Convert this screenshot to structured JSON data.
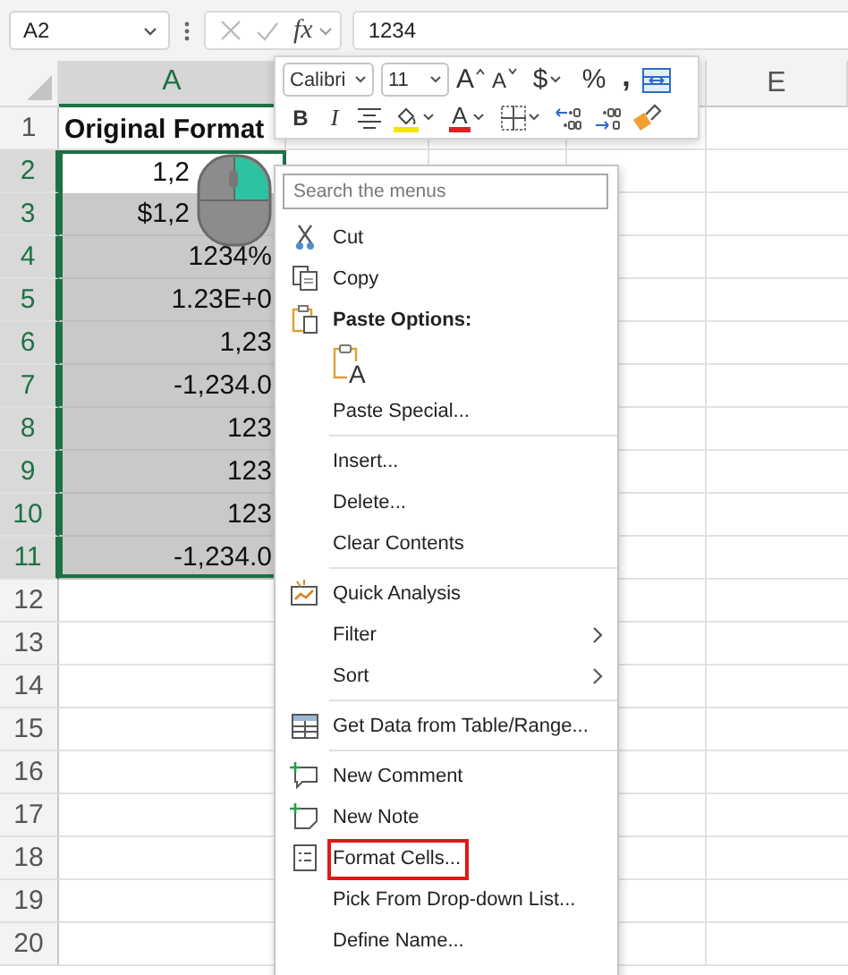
{
  "formula_bar": {
    "name_box": "A2",
    "function_label": "fx",
    "value": "1234"
  },
  "columns": [
    {
      "label": "A",
      "selected": true
    },
    {
      "label": "E",
      "selected": false
    }
  ],
  "rows": [
    {
      "header": "1",
      "kind": "title",
      "cell": "Original Format",
      "selected": false,
      "active": false
    },
    {
      "header": "2",
      "kind": "value",
      "cell": "1,2",
      "selected": true,
      "active": true
    },
    {
      "header": "3",
      "kind": "value",
      "cell": "$1,2",
      "selected": true,
      "active": false
    },
    {
      "header": "4",
      "kind": "value",
      "cell": "1234%",
      "selected": true,
      "active": false
    },
    {
      "header": "5",
      "kind": "value",
      "cell": "1.23E+0",
      "selected": true,
      "active": false
    },
    {
      "header": "6",
      "kind": "value",
      "cell": "1,23",
      "selected": true,
      "active": false
    },
    {
      "header": "7",
      "kind": "value",
      "cell": "-1,234.0",
      "selected": true,
      "active": false
    },
    {
      "header": "8",
      "kind": "value",
      "cell": "123",
      "selected": true,
      "active": false
    },
    {
      "header": "9",
      "kind": "value",
      "cell": "123",
      "selected": true,
      "active": false
    },
    {
      "header": "10",
      "kind": "value",
      "cell": "123",
      "selected": true,
      "active": false
    },
    {
      "header": "11",
      "kind": "value",
      "cell": "-1,234.0",
      "selected": true,
      "active": false
    },
    {
      "header": "12",
      "kind": "blank",
      "selected": false,
      "active": false
    },
    {
      "header": "13",
      "kind": "blank",
      "selected": false,
      "active": false
    },
    {
      "header": "14",
      "kind": "blank",
      "selected": false,
      "active": false
    },
    {
      "header": "15",
      "kind": "blank",
      "selected": false,
      "active": false
    },
    {
      "header": "16",
      "kind": "blank",
      "selected": false,
      "active": false
    },
    {
      "header": "17",
      "kind": "blank",
      "selected": false,
      "active": false
    },
    {
      "header": "18",
      "kind": "blank",
      "selected": false,
      "active": false
    },
    {
      "header": "19",
      "kind": "blank",
      "selected": false,
      "active": false
    },
    {
      "header": "20",
      "kind": "blank",
      "selected": false,
      "active": false
    }
  ],
  "mini_toolbar": {
    "font": "Calibri",
    "size": "11",
    "top_buttons": [
      {
        "kind": "grow",
        "label": "A",
        "dropdown": false
      },
      {
        "kind": "shrink",
        "label": "A",
        "dropdown": false
      },
      {
        "kind": "currency",
        "label": "$",
        "dropdown": true
      },
      {
        "kind": "percent",
        "label": "%",
        "dropdown": false
      },
      {
        "kind": "comma",
        "label": ",",
        "dropdown": false
      },
      {
        "kind": "wrap",
        "dropdown": false
      }
    ],
    "bottom_buttons": [
      {
        "kind": "bold",
        "label": "B",
        "dropdown": false
      },
      {
        "kind": "italic",
        "label": "I",
        "dropdown": false
      },
      {
        "kind": "center",
        "dropdown": false
      },
      {
        "kind": "fill",
        "dropdown": true
      },
      {
        "kind": "font-color",
        "label": "A",
        "dropdown": true
      },
      {
        "kind": "borders",
        "dropdown": true
      },
      {
        "kind": "inc-decimal",
        "dropdown": false
      },
      {
        "kind": "dec-decimal",
        "dropdown": false
      },
      {
        "kind": "painter",
        "dropdown": false
      }
    ]
  },
  "menu": {
    "search_placeholder": "Search the menus",
    "items": [
      {
        "kind": "item",
        "label": "Cut",
        "submenu": false,
        "highlighted": false
      },
      {
        "kind": "item",
        "label": "Copy",
        "submenu": false,
        "highlighted": false
      },
      {
        "kind": "heading",
        "label": "Paste Options:"
      },
      {
        "kind": "paste",
        "label": "A"
      },
      {
        "kind": "item",
        "label": "Paste Special...",
        "submenu": false,
        "highlighted": false
      },
      {
        "kind": "separator"
      },
      {
        "kind": "item",
        "label": "Insert...",
        "submenu": false,
        "highlighted": false
      },
      {
        "kind": "item",
        "label": "Delete...",
        "submenu": false,
        "highlighted": false
      },
      {
        "kind": "item",
        "label": "Clear Contents",
        "submenu": false,
        "highlighted": false
      },
      {
        "kind": "separator"
      },
      {
        "kind": "item",
        "label": "Quick Analysis",
        "submenu": false,
        "highlighted": false
      },
      {
        "kind": "item",
        "label": "Filter",
        "submenu": true,
        "highlighted": false
      },
      {
        "kind": "item",
        "label": "Sort",
        "submenu": true,
        "highlighted": false
      },
      {
        "kind": "separator"
      },
      {
        "kind": "item",
        "label": "Get Data from Table/Range...",
        "submenu": false,
        "highlighted": false
      },
      {
        "kind": "separator"
      },
      {
        "kind": "item",
        "label": "New Comment",
        "submenu": false,
        "highlighted": false
      },
      {
        "kind": "item",
        "label": "New Note",
        "submenu": false,
        "highlighted": false
      },
      {
        "kind": "item",
        "label": "Format Cells...",
        "submenu": false,
        "highlighted": true
      },
      {
        "kind": "item",
        "label": "Pick From Drop-down List...",
        "submenu": false,
        "highlighted": false
      },
      {
        "kind": "item",
        "label": "Define Name...",
        "submenu": false,
        "highlighted": false
      }
    ]
  }
}
